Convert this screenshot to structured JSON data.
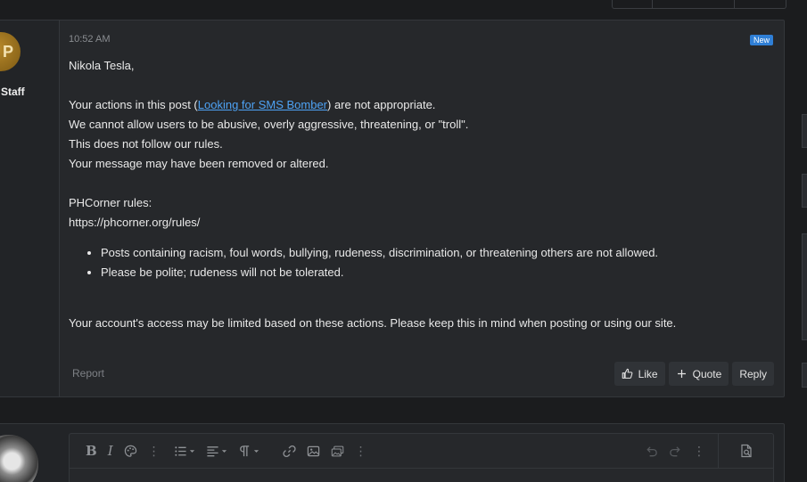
{
  "post": {
    "time": "10:52 AM",
    "badge": "New",
    "user_title": "Staff",
    "avatar_initial": "P",
    "greeting": "Nikola Tesla,",
    "line1_before": "Your actions in this post (",
    "line1_link": "Looking for SMS Bomber",
    "line1_after": ") are not appropriate.",
    "line2": "We cannot allow users to be abusive, overly aggressive, threatening, or \"troll\".",
    "line3": "This does not follow our rules.",
    "line4": "Your message may have been removed or altered.",
    "rules_label": "PHCorner rules:",
    "rules_url": "https://phcorner.org/rules/",
    "bullets": [
      "Posts containing racism, foul words, bullying, rudeness, discrimination, or threatening others are not allowed.",
      "Please be polite; rudeness will not be tolerated."
    ],
    "closing": "Your account's access may be limited based on these actions. Please keep this in mind when posting or using our site.",
    "report_label": "Report",
    "like_label": "Like",
    "quote_label": "Quote",
    "reply_label": "Reply"
  },
  "editor": {
    "tools": [
      "bold-icon",
      "italic-icon",
      "palette-icon",
      "list-icon",
      "align-icon",
      "paragraph-icon",
      "link-icon",
      "image-icon",
      "media-icon",
      "undo-icon",
      "redo-icon",
      "preview-icon"
    ]
  },
  "colors": {
    "background": "#1b1c1e",
    "panel": "#26282b",
    "link": "#4ea3f5",
    "badge": "#2f7fd6",
    "coin": "#b8892a"
  }
}
